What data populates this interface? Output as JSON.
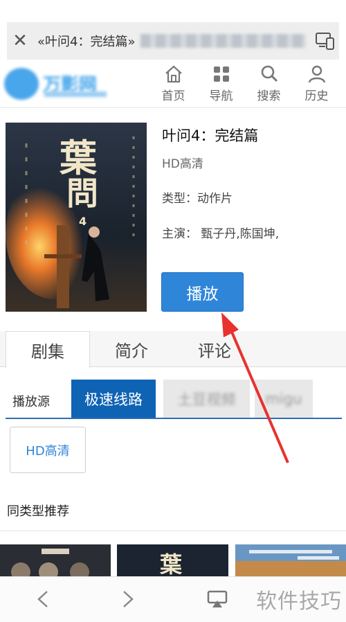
{
  "browser": {
    "page_title": "«叶问4：完结篇»",
    "close_icon": "close-icon",
    "device_icon": "multi-device-icon"
  },
  "site": {
    "nav": [
      {
        "label": "首页",
        "icon": "home-icon"
      },
      {
        "label": "导航",
        "icon": "grid-icon"
      },
      {
        "label": "搜索",
        "icon": "search-icon"
      },
      {
        "label": "历史",
        "icon": "user-icon"
      }
    ]
  },
  "movie": {
    "title": "叶问4：完结篇",
    "quality": "HD高清",
    "type_text": "类型：动作片",
    "cast_text": "主演： 甄子丹,陈国坤,",
    "play_label": "播放"
  },
  "tabs": [
    {
      "label": "剧集"
    },
    {
      "label": "简介"
    },
    {
      "label": "评论"
    }
  ],
  "sources": {
    "label": "播放源",
    "items": [
      "极速线路",
      "土豆视频",
      "migu"
    ]
  },
  "episode": {
    "label": "HD高清"
  },
  "recommend": {
    "title": "同类型推荐"
  },
  "watermark": "软件技巧",
  "colors": {
    "accent": "#2f86d9",
    "source_active": "#0f63b4",
    "arrow": "#e8322e"
  }
}
